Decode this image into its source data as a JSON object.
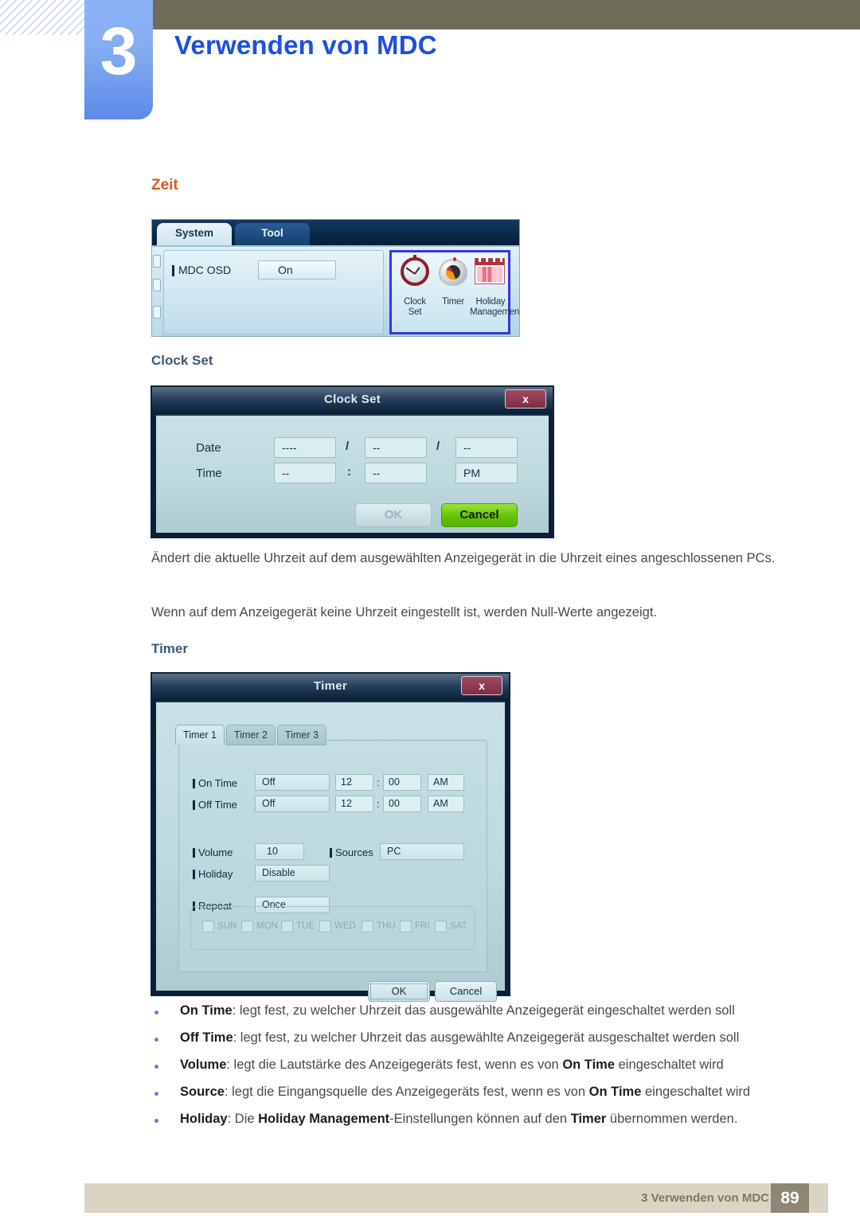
{
  "header": {
    "chapter_number": "3",
    "chapter_title": "Verwenden von MDC"
  },
  "section": {
    "heading": "Zeit"
  },
  "mdc_panel": {
    "tabs": [
      {
        "label": "System",
        "active": true
      },
      {
        "label": "Tool",
        "active": false
      }
    ],
    "osd_label": "MDC OSD",
    "osd_value": "On",
    "icons": [
      {
        "name": "clock-set-icon",
        "caption_line1": "Clock",
        "caption_line2": "Set"
      },
      {
        "name": "timer-icon",
        "caption_line1": "Timer",
        "caption_line2": ""
      },
      {
        "name": "holiday-management-icon",
        "caption_line1": "Holiday",
        "caption_line2": "Management"
      }
    ],
    "highlight_color": "#3b34e0"
  },
  "clock_set": {
    "sub_heading": "Clock Set",
    "dialog_title": "Clock Set",
    "close_label": "x",
    "date_label": "Date",
    "time_label": "Time",
    "date_year": "----",
    "date_month": "--",
    "date_day": "--",
    "time_hour": "--",
    "time_minute": "--",
    "time_meridiem": "PM",
    "separator_date": "/",
    "separator_time": ":",
    "ok_label": "OK",
    "cancel_label": "Cancel",
    "cancel_color": "#63c304"
  },
  "paragraphs": {
    "p1": "Ändert die aktuelle Uhrzeit auf dem ausgewählten Anzeigegerät in die Uhrzeit eines angeschlossenen PCs.",
    "p2": "Wenn auf dem Anzeigegerät keine Uhrzeit eingestellt ist, werden Null-Werte angezeigt."
  },
  "timer": {
    "sub_heading": "Timer",
    "dialog_title": "Timer",
    "close_label": "x",
    "tabs": [
      {
        "label": "Timer 1",
        "active": true
      },
      {
        "label": "Timer 2",
        "active": false
      },
      {
        "label": "Timer 3",
        "active": false
      }
    ],
    "rows": {
      "on_time_label": "On Time",
      "on_time_mode": "Off",
      "on_time_hour": "12",
      "on_time_minute": "00",
      "on_time_meridiem": "AM",
      "off_time_label": "Off Time",
      "off_time_mode": "Off",
      "off_time_hour": "12",
      "off_time_minute": "00",
      "off_time_meridiem": "AM",
      "volume_label": "Volume",
      "volume_value": "10",
      "sources_label": "Sources",
      "sources_value": "PC",
      "holiday_label": "Holiday",
      "holiday_value": "Disable",
      "repeat_label": "Repeat",
      "repeat_value": "Once",
      "colon": ":"
    },
    "days": [
      {
        "label": "SUN",
        "checked": false
      },
      {
        "label": "MON",
        "checked": false
      },
      {
        "label": "TUE",
        "checked": false
      },
      {
        "label": "WED",
        "checked": false
      },
      {
        "label": "THU",
        "checked": false
      },
      {
        "label": "FRI",
        "checked": false
      },
      {
        "label": "SAT",
        "checked": false
      }
    ],
    "ok_label": "OK",
    "cancel_label": "Cancel"
  },
  "bullets": [
    {
      "term": "On Time",
      "rest_html": ": legt fest, zu welcher Uhrzeit das ausgewählte Anzeigegerät eingeschaltet werden soll"
    },
    {
      "term": "Off Time",
      "rest_html": ": legt fest, zu welcher Uhrzeit das ausgewählte Anzeigegerät ausgeschaltet werden soll"
    },
    {
      "term": "Volume",
      "rest_html": ": legt die Lautstärke des Anzeigegeräts fest, wenn es von <b>On Time</b> eingeschaltet wird"
    },
    {
      "term": "Source",
      "rest_html": ": legt die Eingangsquelle des Anzeigegeräts fest, wenn es von <b>On Time</b> eingeschaltet wird"
    },
    {
      "term": "Holiday",
      "rest_html": ": Die <b>Holiday Management</b>-Einstellungen können auf den <b>Timer</b> übernommen werden."
    }
  ],
  "footer": {
    "text": "3 Verwenden von MDC",
    "page": "89"
  }
}
